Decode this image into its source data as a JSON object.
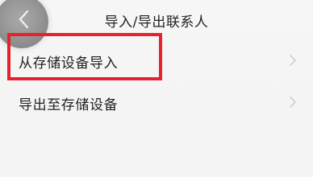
{
  "header": {
    "title": "导入/导出联系人",
    "back_icon": "chevron-left-icon"
  },
  "list": {
    "items": [
      {
        "label": "从存储设备导入",
        "icon": "chevron-right-icon",
        "highlighted": true
      },
      {
        "label": "导出至存储设备",
        "icon": "chevron-right-icon",
        "highlighted": false
      }
    ]
  },
  "colors": {
    "background": "#f4f4f4",
    "text": "#222222",
    "highlight": "#e8222b",
    "chevron": "#c8c8c8"
  }
}
